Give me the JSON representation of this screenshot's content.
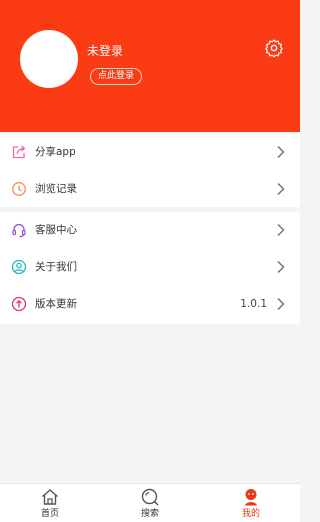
{
  "header": {
    "username": "未登录",
    "login_button": "点此登录",
    "settings_icon": "gear-icon",
    "background": "#fb3b13"
  },
  "menu_group1": [
    {
      "label": "分享app",
      "icon": "share-icon"
    },
    {
      "label": "浏览记录",
      "icon": "clock-icon"
    }
  ],
  "menu_group2": [
    {
      "label": "客服中心",
      "icon": "headset-icon"
    },
    {
      "label": "关于我们",
      "icon": "user-circle-icon"
    },
    {
      "label": "版本更新",
      "icon": "upload-circle-icon",
      "value": "1.0.1"
    }
  ],
  "bottom_nav": [
    {
      "label": "首页",
      "icon": "home-icon",
      "active": false
    },
    {
      "label": "搜索",
      "icon": "search-icon",
      "active": false
    },
    {
      "label": "我的",
      "icon": "user-icon",
      "active": true
    }
  ],
  "colors": {
    "accent": "#fb3b13",
    "active_nav": "#e83a12"
  }
}
